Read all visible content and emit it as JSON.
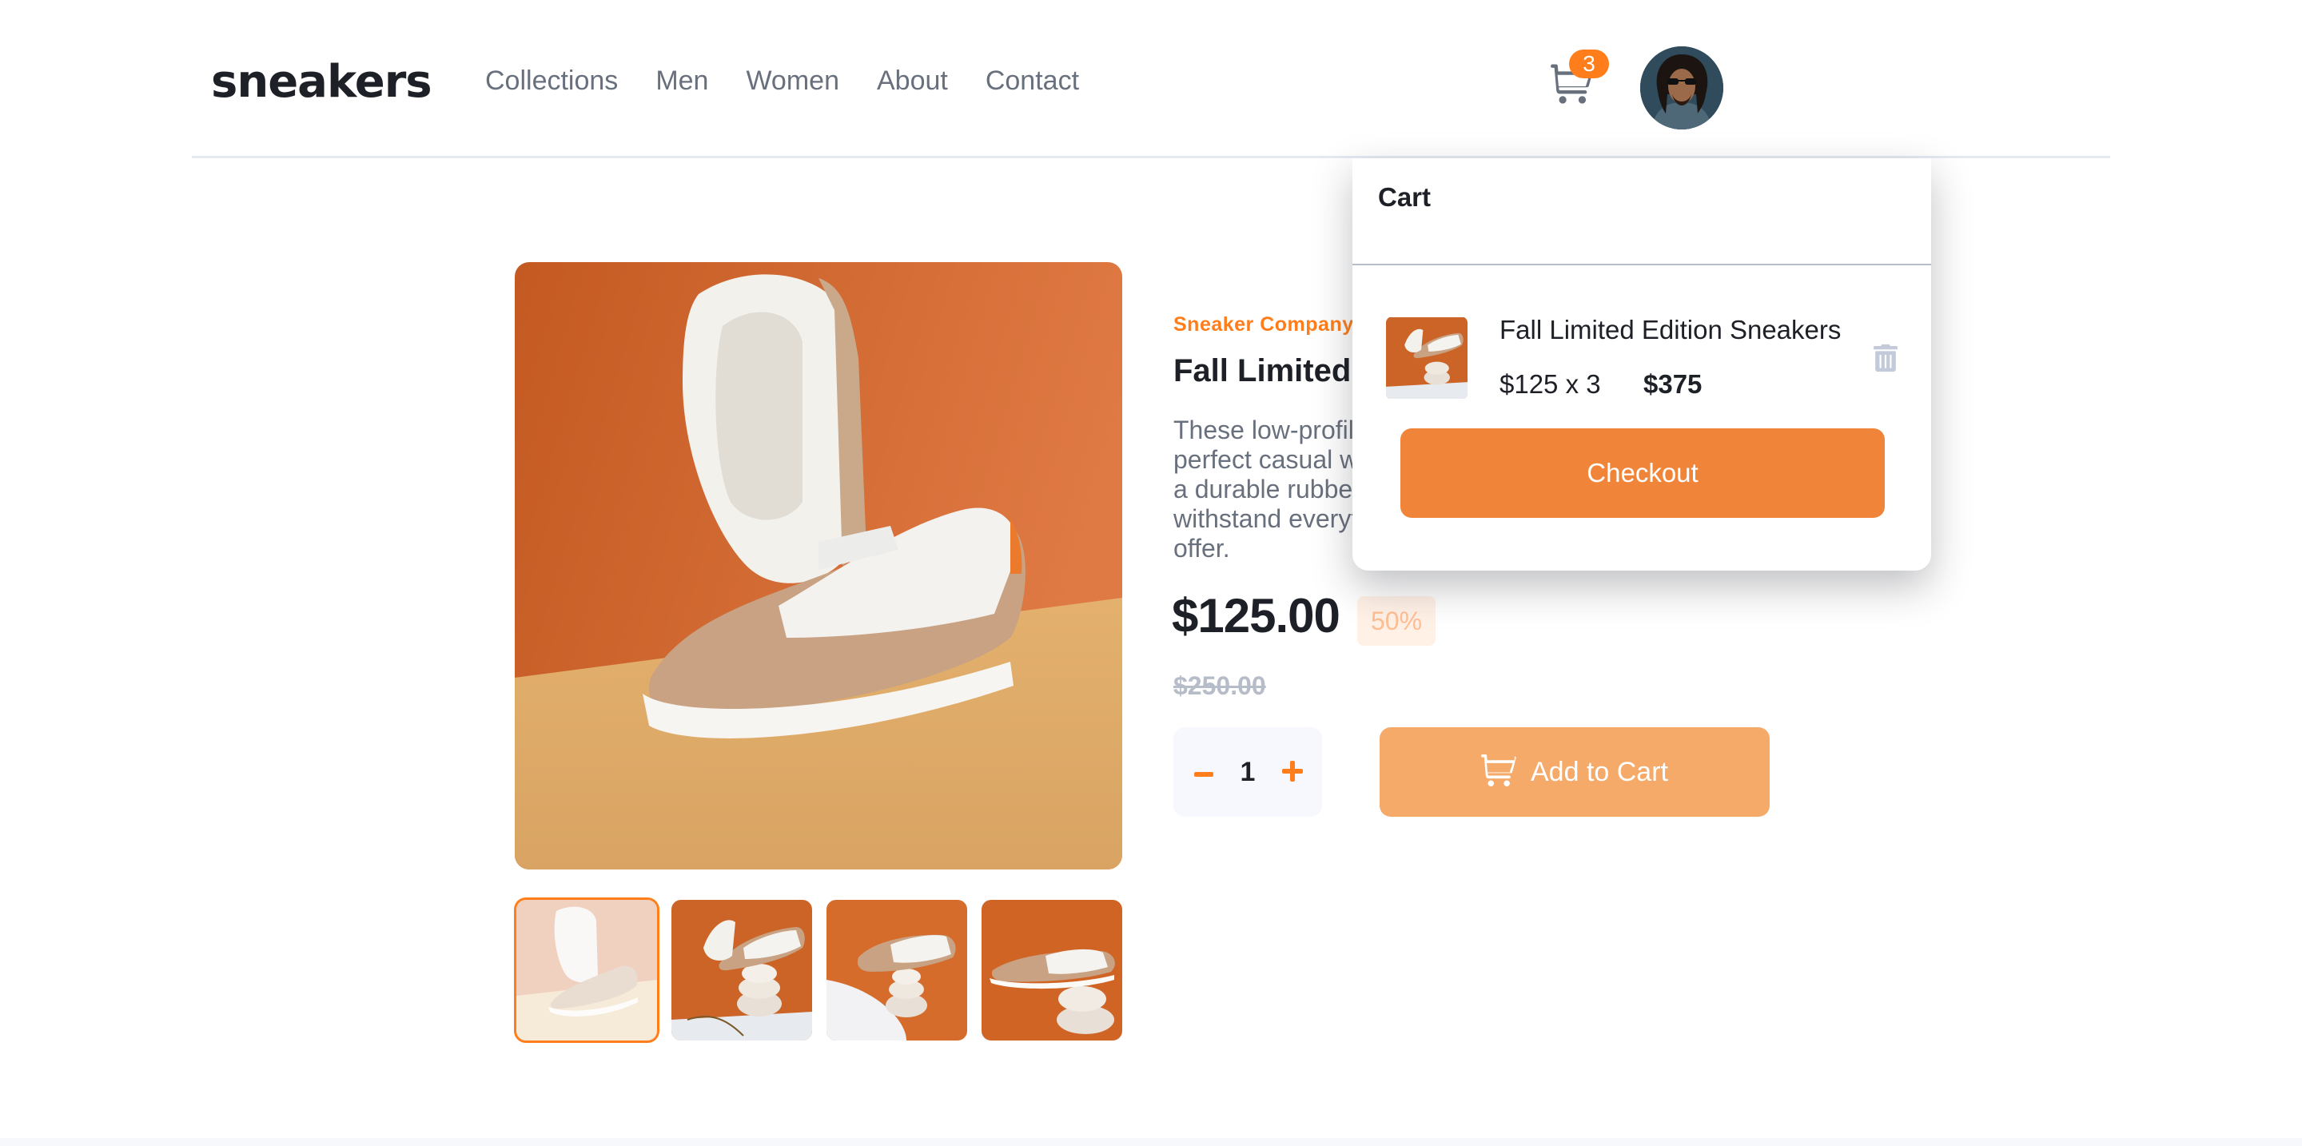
{
  "brand": {
    "logo_text": "sneakers",
    "accent_color": "#ff7e1b"
  },
  "nav": {
    "items": [
      "Collections",
      "Men",
      "Women",
      "About",
      "Contact"
    ]
  },
  "header": {
    "cart_icon": "cart-icon",
    "cart_count": "3",
    "avatar_icon": "user-avatar"
  },
  "gallery": {
    "thumbnails": [
      "product-1",
      "product-2",
      "product-3",
      "product-4"
    ],
    "active_thumbnail": 0
  },
  "product": {
    "company": "Sneaker Company",
    "title": "Fall Limited Edition Sneakers",
    "description_lines": [
      "These low-profile sneakers are your",
      "perfect casual wear companion. Featuring",
      "a durable rubber outer sole, they'll",
      "withstand everything the weather can",
      "offer."
    ],
    "price": "$125.00",
    "discount": "50%",
    "original_price": "$250.00",
    "quantity": "1",
    "add_to_cart_label": "Add to Cart"
  },
  "cart": {
    "title": "Cart",
    "item": {
      "name": "Fall Limited Edition Sneakers",
      "calc": "$125 x 3",
      "total": "$375",
      "delete_icon": "trash-icon"
    },
    "checkout_label": "Checkout"
  }
}
